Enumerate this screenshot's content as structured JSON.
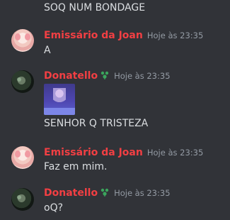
{
  "messages": [
    {
      "text": "SOQ NUM BONDAGE"
    },
    {
      "author": "Emissário da Joan",
      "time": "Hoje às 23:35",
      "text": "A",
      "avatar_icon": "pink-anime-avatar-icon"
    },
    {
      "author": "Donatello",
      "time": "Hoje às 23:35",
      "text": "SENHOR Q TRISTEZA",
      "avatar_icon": "dark-green-avatar-icon",
      "badge_icon": "green-leaf-badge-icon",
      "attachment": "image-attachment"
    },
    {
      "author": "Emissário da Joan",
      "time": "Hoje às 23:35",
      "text": "Faz em mim."
    },
    {
      "author": "Donatello",
      "time": "Hoje às 23:35",
      "text": "oQ?"
    }
  ],
  "colors": {
    "background": "#313338",
    "author_name": "#f23f43",
    "timestamp": "#949ba4",
    "message_text": "#dbdee1",
    "badge": "#3ba55c"
  }
}
